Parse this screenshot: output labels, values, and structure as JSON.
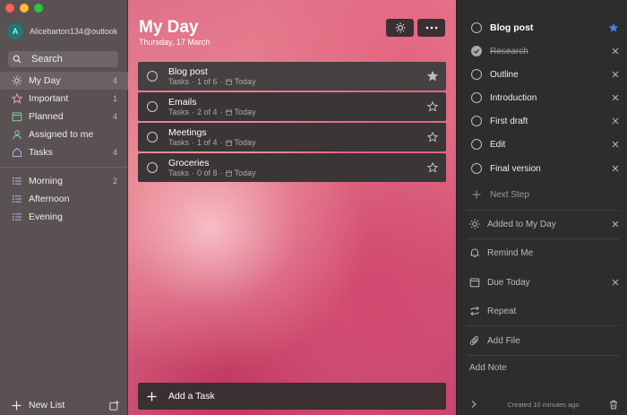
{
  "account": {
    "initial": "A",
    "email": "Alicebarton134@outlook"
  },
  "search": {
    "label": "Search"
  },
  "sidebar": {
    "smart_lists": [
      {
        "id": "my-day",
        "label": "My Day",
        "count": "4",
        "icon": "sun-icon"
      },
      {
        "id": "important",
        "label": "Important",
        "count": "1",
        "icon": "star-icon"
      },
      {
        "id": "planned",
        "label": "Planned",
        "count": "4",
        "icon": "calendar-icon"
      },
      {
        "id": "assigned",
        "label": "Assigned to me",
        "count": "",
        "icon": "person-icon"
      },
      {
        "id": "tasks",
        "label": "Tasks",
        "count": "4",
        "icon": "home-icon"
      }
    ],
    "lists": [
      {
        "id": "morning",
        "label": "Morning",
        "count": "2",
        "icon": "list-icon"
      },
      {
        "id": "afternoon",
        "label": "Afternoon",
        "count": "",
        "icon": "list-icon"
      },
      {
        "id": "evening",
        "label": "Evening",
        "count": "",
        "icon": "list-icon"
      }
    ],
    "new_list_label": "New List"
  },
  "main": {
    "title": "My Day",
    "date": "Thursday, 17 March",
    "tasks": [
      {
        "title": "Blog post",
        "list": "Tasks",
        "progress": "1 of 6",
        "due": "Today",
        "starred": true
      },
      {
        "title": "Emails",
        "list": "Tasks",
        "progress": "2 of 4",
        "due": "Today",
        "starred": false
      },
      {
        "title": "Meetings",
        "list": "Tasks",
        "progress": "1 of 4",
        "due": "Today",
        "starred": false
      },
      {
        "title": "Groceries",
        "list": "Tasks",
        "progress": "0 of 8",
        "due": "Today",
        "starred": false
      }
    ],
    "add_task_label": "Add a Task"
  },
  "detail": {
    "task_title": "Blog post",
    "steps": [
      {
        "label": "Research",
        "done": true
      },
      {
        "label": "Outline",
        "done": false
      },
      {
        "label": "Introduction",
        "done": false
      },
      {
        "label": "First draft",
        "done": false
      },
      {
        "label": "Edit",
        "done": false
      },
      {
        "label": "Final version",
        "done": false
      }
    ],
    "next_step_label": "Next Step",
    "added_to_my_day_label": "Added to My Day",
    "remind_me_label": "Remind Me",
    "due_label": "Due Today",
    "repeat_label": "Repeat",
    "add_file_label": "Add File",
    "add_note_label": "Add Note",
    "created_label": "Created 10 minutes ago"
  },
  "colors": {
    "star_active": "#4a7fe8",
    "due_blue": "#8ea7d9"
  }
}
